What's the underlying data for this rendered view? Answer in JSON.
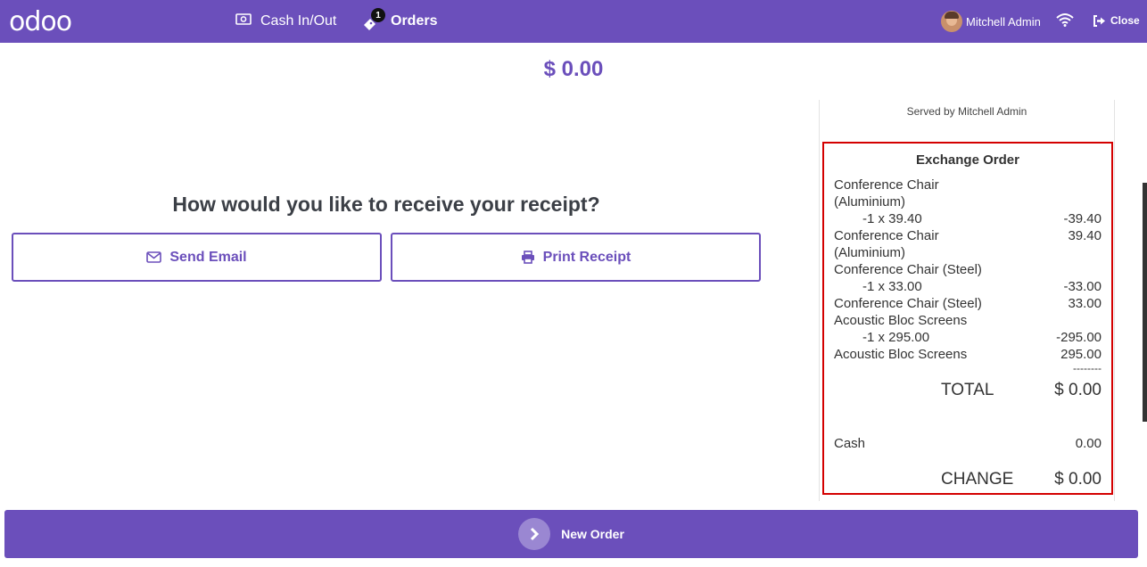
{
  "header": {
    "logo_text": "odoo",
    "cash_label": "Cash In/Out",
    "orders_label": "Orders",
    "orders_badge": "1",
    "user_name": "Mitchell Admin",
    "close_label": "Close",
    "brand_color": "#6b4fbb"
  },
  "payment": {
    "amount": "$ 0.00",
    "question": "How would you like to receive your receipt?",
    "send_email_label": "Send Email",
    "print_receipt_label": "Print Receipt"
  },
  "receipt": {
    "served_by": "Served by Mitchell Admin",
    "title": "Exchange Order",
    "lines": [
      {
        "name": "Conference Chair",
        "val": ""
      },
      {
        "name": "(Aluminium)",
        "val": ""
      },
      {
        "qty": "-1 x 39.40",
        "val": "-39.40"
      },
      {
        "name": "Conference Chair",
        "val": "39.40"
      },
      {
        "name": "(Aluminium)",
        "val": ""
      },
      {
        "name": "Conference Chair (Steel)",
        "val": ""
      },
      {
        "qty": "-1 x 33.00",
        "val": "-33.00"
      },
      {
        "name": "Conference Chair (Steel)",
        "val": "33.00"
      },
      {
        "name": "Acoustic Bloc Screens",
        "val": ""
      },
      {
        "qty": "-1 x 295.00",
        "val": "-295.00"
      },
      {
        "name": "Acoustic Bloc Screens",
        "val": "295.00"
      }
    ],
    "separator": "--------",
    "total_label": "TOTAL",
    "total_value": "$ 0.00",
    "cash_label": "Cash",
    "cash_value": "0.00",
    "change_label": "CHANGE",
    "change_value": "$ 0.00"
  },
  "footer": {
    "new_order_label": "New Order"
  }
}
